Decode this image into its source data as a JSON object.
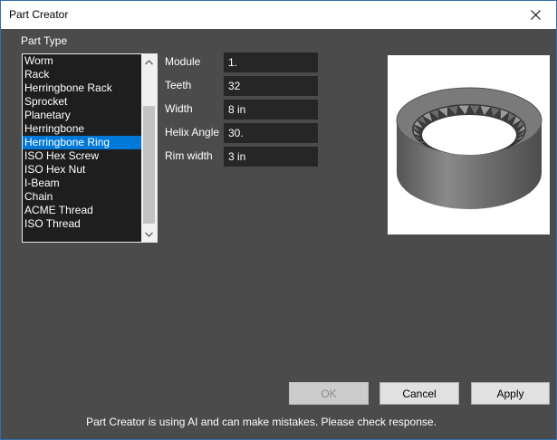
{
  "window": {
    "title": "Part Creator",
    "close_icon": "close-icon"
  },
  "part_type": {
    "label": "Part Type",
    "items": [
      "Worm",
      "Rack",
      "Herringbone Rack",
      "Sprocket",
      "Planetary",
      "Herringbone",
      "Herringbone Ring",
      "ISO Hex Screw",
      "ISO Hex Nut",
      "I-Beam",
      "Chain",
      "ACME Thread",
      "ISO Thread"
    ],
    "selected": "Herringbone Ring",
    "scroll_up_icon": "chevron-up-icon",
    "scroll_down_icon": "chevron-down-icon"
  },
  "params": {
    "module": {
      "label": "Module",
      "value": "1."
    },
    "teeth": {
      "label": "Teeth",
      "value": "32"
    },
    "width": {
      "label": "Width",
      "value": "8 in"
    },
    "helix_angle": {
      "label": "Helix Angle",
      "value": "30."
    },
    "rim_width": {
      "label": "Rim width",
      "value": "3 in"
    }
  },
  "preview": {
    "icon": "herringbone-ring-gear-preview"
  },
  "buttons": {
    "ok": "OK",
    "cancel": "Cancel",
    "apply": "Apply"
  },
  "footer": {
    "note": "Part Creator is using AI and can make mistakes. Please check response."
  },
  "colors": {
    "background": "#4b4b4b",
    "selection": "#0078d7",
    "input_bg": "#262626"
  }
}
